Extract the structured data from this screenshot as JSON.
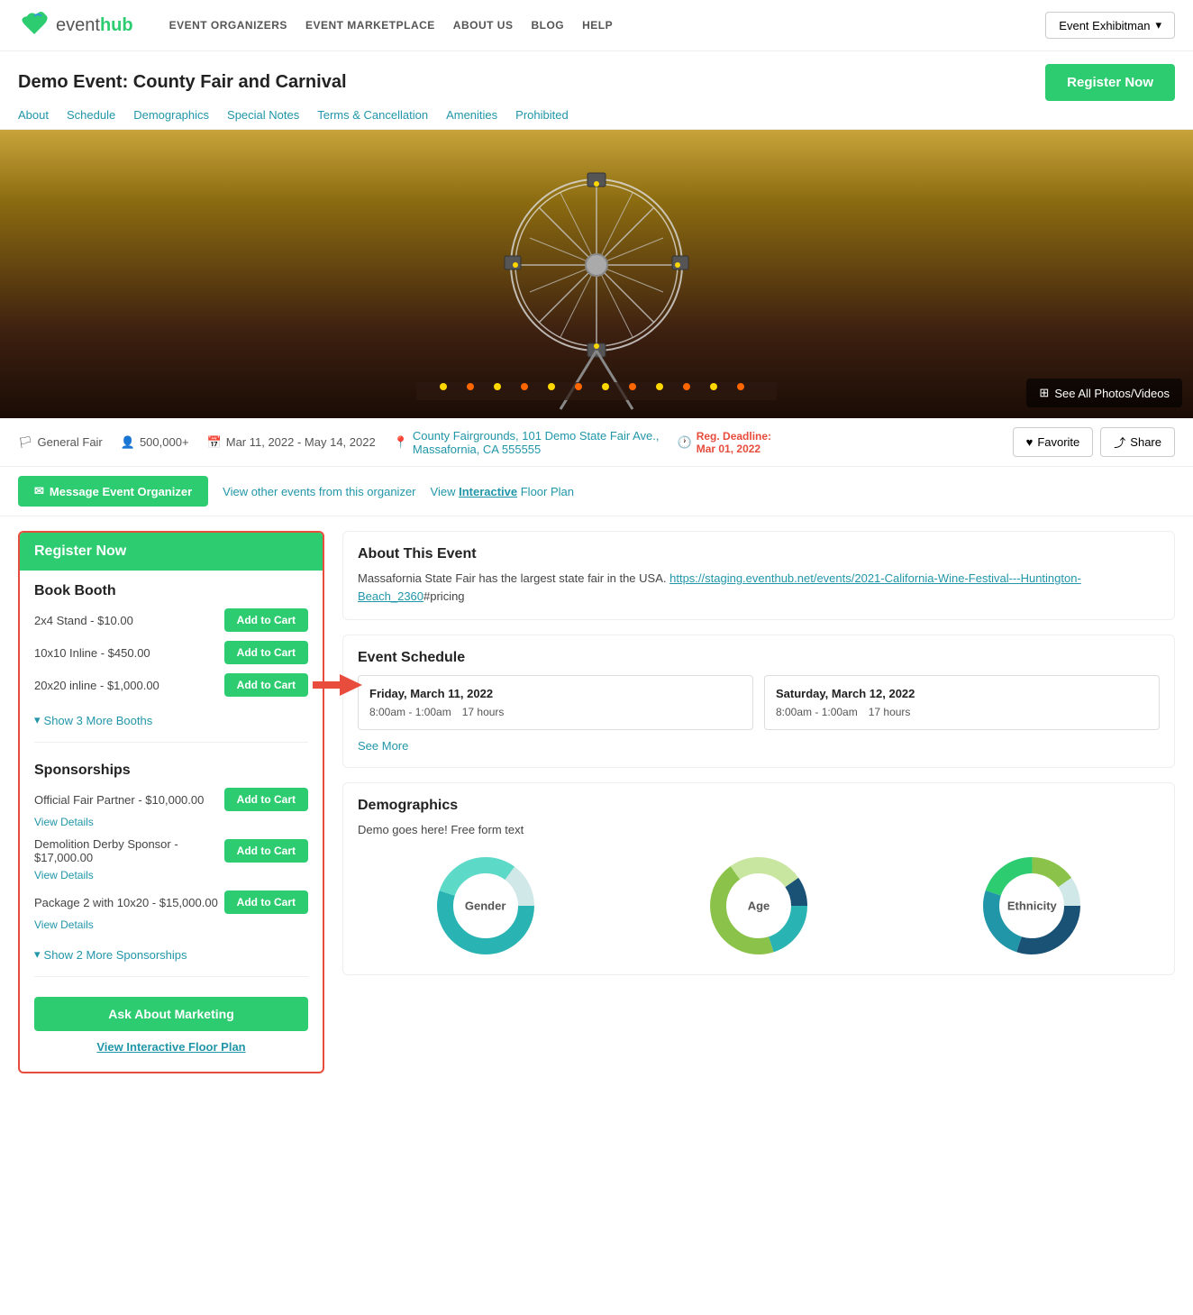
{
  "nav": {
    "logo_event": "event",
    "logo_hub": "hub",
    "links": [
      {
        "label": "EVENT ORGANIZERS",
        "href": "#"
      },
      {
        "label": "EVENT MARKETPLACE",
        "href": "#"
      },
      {
        "label": "ABOUT US",
        "href": "#"
      },
      {
        "label": "BLOG",
        "href": "#"
      },
      {
        "label": "HELP",
        "href": "#"
      }
    ],
    "user_btn": "Event Exhibitman"
  },
  "page": {
    "title": "Demo Event: County Fair and Carnival",
    "register_btn": "Register Now"
  },
  "tabs": [
    {
      "label": "About"
    },
    {
      "label": "Schedule"
    },
    {
      "label": "Demographics"
    },
    {
      "label": "Special Notes"
    },
    {
      "label": "Terms & Cancellation"
    },
    {
      "label": "Amenities"
    },
    {
      "label": "Prohibited"
    }
  ],
  "hero": {
    "photos_btn": "See All Photos/Videos"
  },
  "meta": {
    "type": "General Fair",
    "attendees": "500,000+",
    "dates": "Mar 11, 2022 - May 14, 2022",
    "location_line1": "County Fairgrounds, 101 Demo State Fair Ave.,",
    "location_line2": "Massafornia, CA 555555",
    "deadline_label": "Reg. Deadline:",
    "deadline_date": "Mar 01, 2022",
    "fav_btn": "Favorite",
    "share_btn": "Share"
  },
  "actions": {
    "msg_btn": "Message Event Organizer",
    "other_events": "View other events from this organizer",
    "floor_plan": "View Interactive Floor Plan"
  },
  "sidebar": {
    "header": "Register Now",
    "book_booth_title": "Book Booth",
    "booths": [
      {
        "name": "2x4 Stand - $10.00",
        "btn": "Add to Cart"
      },
      {
        "name": "10x10 Inline - $450.00",
        "btn": "Add to Cart"
      },
      {
        "name": "20x20 inline - $1,000.00",
        "btn": "Add to Cart"
      }
    ],
    "show_more_booths": "Show 3 More Booths",
    "sponsorships_title": "Sponsorships",
    "sponsorships": [
      {
        "name": "Official Fair Partner - $10,000.00",
        "btn": "Add to Cart",
        "details": "View Details"
      },
      {
        "name": "Demolition Derby Sponsor - $17,000.00",
        "btn": "Add to Cart",
        "details": "View Details"
      },
      {
        "name": "Package 2 with 10x20 - $15,000.00",
        "btn": "Add to Cart",
        "details": "View Details"
      }
    ],
    "show_more_sponsorships": "Show 2 More Sponsorships",
    "ask_marketing_btn": "Ask About Marketing",
    "floor_plan_link_text": "View ",
    "floor_plan_link_interactive": "Interactive",
    "floor_plan_link_rest": " Floor Plan"
  },
  "about": {
    "title": "About This Event",
    "text": "Massafornia State Fair has the largest state fair in the USA. ",
    "link_text": "https://staging.eventhub.net/events/2021-California-Wine-Festival---Huntington-Beach_2360",
    "link_suffix": "#pricing"
  },
  "schedule": {
    "title": "Event Schedule",
    "days": [
      {
        "day": "Friday, March 11, 2022",
        "time": "8:00am - 1:00am",
        "hours": "17 hours"
      },
      {
        "day": "Saturday, March 12, 2022",
        "time": "8:00am - 1:00am",
        "hours": "17 hours"
      }
    ],
    "see_more": "See More"
  },
  "demographics": {
    "title": "Demographics",
    "text": "Demo goes here! Free form text",
    "charts": [
      {
        "label": "Gender",
        "segments": [
          {
            "color": "#2ab3b3",
            "pct": 55
          },
          {
            "color": "#5dd9c8",
            "pct": 30
          },
          {
            "color": "#d0e8e8",
            "pct": 15
          }
        ]
      },
      {
        "label": "Age",
        "segments": [
          {
            "color": "#2ab3b3",
            "pct": 20
          },
          {
            "color": "#8bc34a",
            "pct": 45
          },
          {
            "color": "#c8e6a0",
            "pct": 25
          },
          {
            "color": "#1a5276",
            "pct": 10
          }
        ]
      },
      {
        "label": "Ethnicity",
        "segments": [
          {
            "color": "#1a5276",
            "pct": 30
          },
          {
            "color": "#2196a8",
            "pct": 25
          },
          {
            "color": "#2ecc71",
            "pct": 20
          },
          {
            "color": "#8bc34a",
            "pct": 15
          },
          {
            "color": "#d0e8e8",
            "pct": 10
          }
        ]
      }
    ]
  },
  "colors": {
    "green": "#2ecc71",
    "teal": "#2196a8",
    "red": "#e74c3c"
  }
}
